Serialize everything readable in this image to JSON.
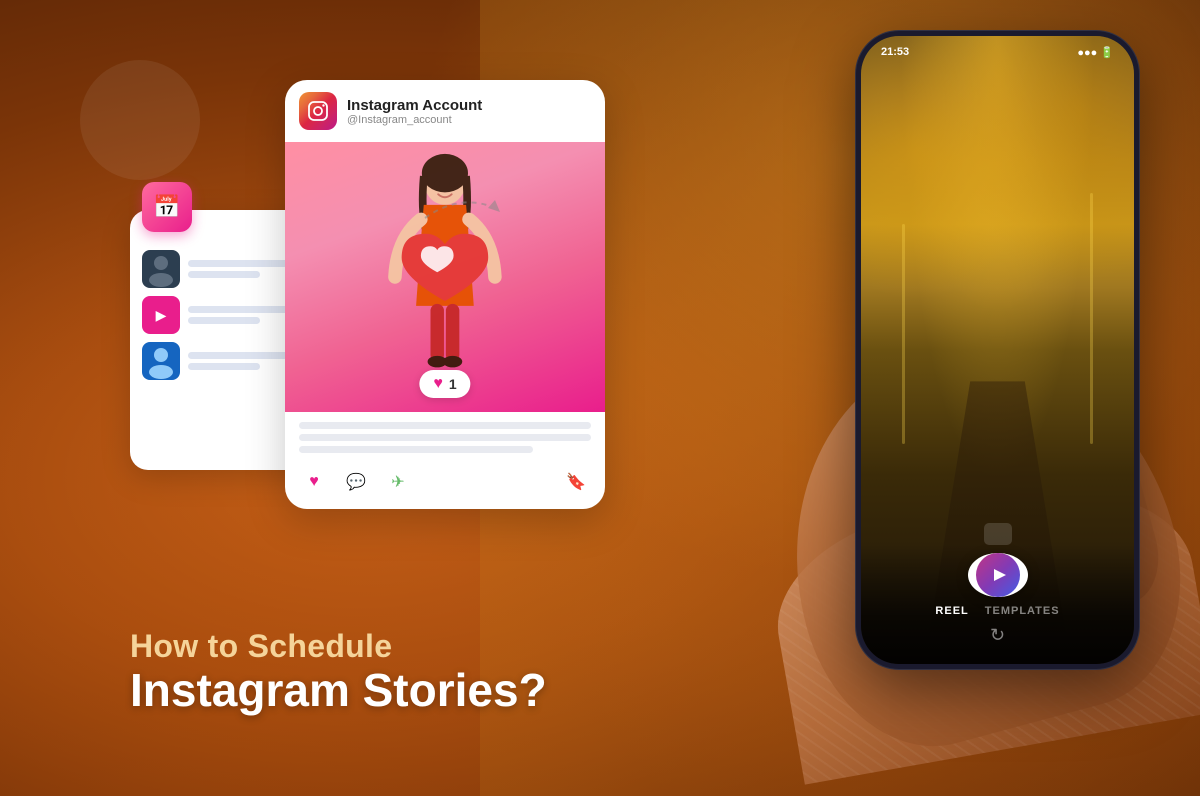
{
  "background": {
    "gradient_desc": "warm orange-brown bokeh background"
  },
  "instagram_card": {
    "account_name": "Instagram Account",
    "account_handle": "@Instagram_account",
    "like_count": "1",
    "logo_icon": "instagram-icon"
  },
  "scheduler_card": {
    "icon": "calendar-icon",
    "rows": [
      {
        "type": "dark-person",
        "checked": false
      },
      {
        "type": "pink-video",
        "checked": true
      },
      {
        "type": "blue-person",
        "checked": true
      }
    ]
  },
  "phone": {
    "status_time": "21:53",
    "screen_content": "autumn-street-photo",
    "reel_label": "REEL",
    "templates_label": "TEMPLATES"
  },
  "text_block": {
    "line1": "How to Schedule",
    "line2": "Instagram Stories?"
  },
  "decorative": {
    "arrow_desc": "dashed arrow pointing right"
  }
}
